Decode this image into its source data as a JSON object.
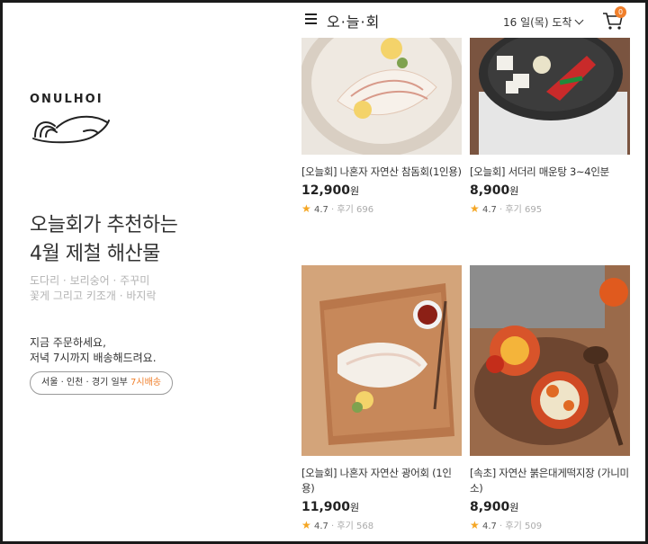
{
  "brand": {
    "logo_text": "ONULHOI",
    "app_title": "오·늘·회"
  },
  "header": {
    "delivery_date": "16 일(목) 도착",
    "cart_count": "0"
  },
  "promo": {
    "headline_1": "오늘회가 추천하는",
    "headline_2": "4월 제철 해산물",
    "sub_1": "도다리 · 보리숭어 · 주꾸미",
    "sub_2": "꽃게 그리고 키조개 · 바지락",
    "order_1": "지금 주문하세요,",
    "order_2": "저녁 7시까지 배송해드려요.",
    "area": "서울 · 인천 · 경기 일부",
    "area_time": "7시배송"
  },
  "products": [
    {
      "title": "[오늘회] 나혼자 자연산 참돔회(1인용)",
      "price": "12,900",
      "unit": "원",
      "rating": "4.7",
      "reviews": "· 후기 696"
    },
    {
      "title": "[오늘회] 서더리 매운탕 3~4인분",
      "price": "8,900",
      "unit": "원",
      "rating": "4.7",
      "reviews": "· 후기 695"
    },
    {
      "title": "[오늘회] 나혼자 자연산 광어회 (1인용)",
      "price": "11,900",
      "unit": "원",
      "rating": "4.7",
      "reviews": "· 후기 568"
    },
    {
      "title": "[속초] 자연산 붉은대게떡지장 (가니미소)",
      "price": "8,900",
      "unit": "원",
      "rating": "4.7",
      "reviews": "· 후기 509"
    }
  ],
  "icons": {
    "menu": "hamburger-icon",
    "cart": "cart-icon",
    "star": "star-icon",
    "dropdown": "chevron-down-icon"
  },
  "colors": {
    "accent": "#f07f2b",
    "star": "#f5a623"
  }
}
